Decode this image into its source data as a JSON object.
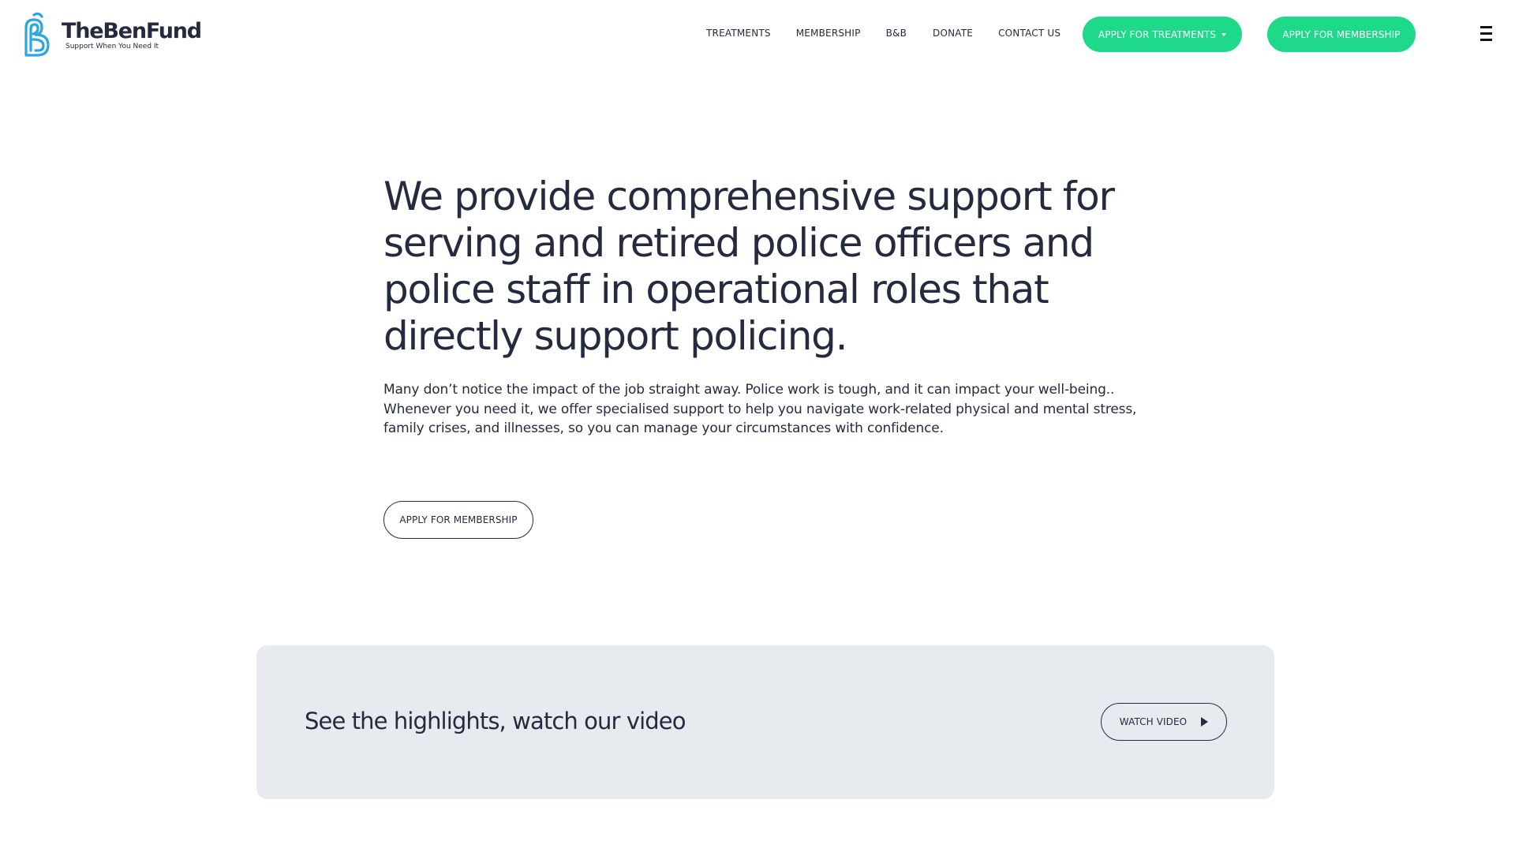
{
  "colors": {
    "text": "#262a3e",
    "accent": "#1fd98a",
    "logo_blue": "#2aa6e0",
    "card_bg": "#e7eaee"
  },
  "brand": {
    "name": "TheBenFund",
    "tagline": "Support When You Need It",
    "logo_icon": "b-monogram-icon"
  },
  "nav": {
    "items": [
      {
        "label": "TREATMENTS"
      },
      {
        "label": "MEMBERSHIP"
      },
      {
        "label": "B&B"
      },
      {
        "label": "DONATE"
      },
      {
        "label": "CONTACT US"
      }
    ],
    "apply_treatments": "APPLY FOR TREATMENTS",
    "apply_membership": "APPLY FOR MEMBERSHIP",
    "menu_icon": "hamburger-menu-icon"
  },
  "hero": {
    "title": "We provide comprehensive support for serving and retired police officers and police staff in operational roles that directly support policing.",
    "body": "Many don’t notice the impact of the job straight away. Police work is tough, and it can impact your well-being.. Whenever you need it, we offer specialised support to help you navigate work-related physical and mental stress, family crises, and illnesses, so you can manage your circumstances with confidence.",
    "cta": "APPLY FOR MEMBERSHIP"
  },
  "video": {
    "title": "See the highlights, watch our video",
    "button": "WATCH VIDEO",
    "button_icon": "play-icon"
  }
}
